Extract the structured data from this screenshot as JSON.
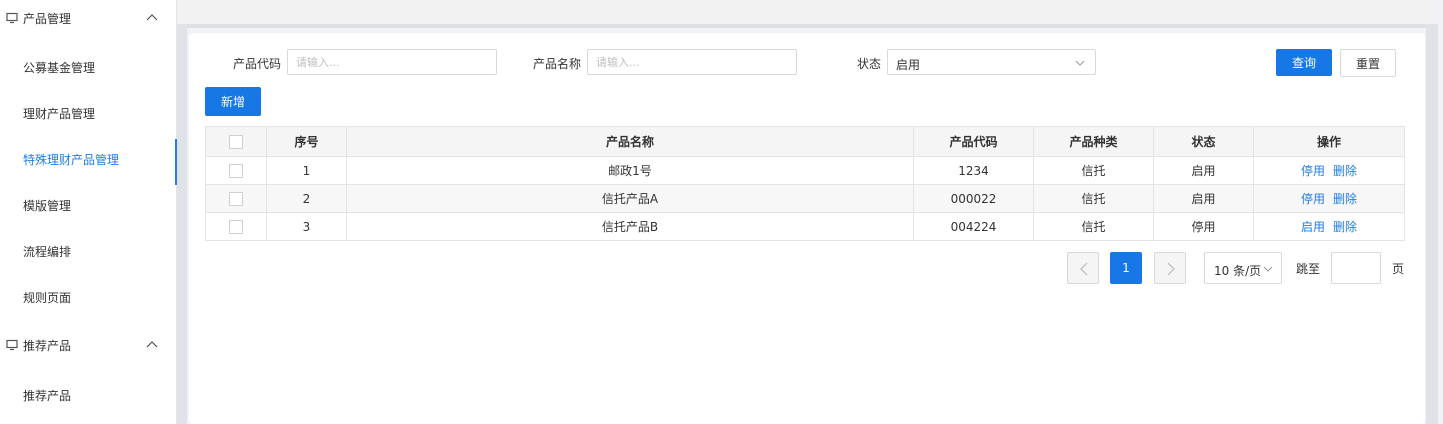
{
  "sidebar": {
    "groups": [
      {
        "label": "产品管理",
        "icon": "monitor-icon",
        "expanded": true,
        "items": [
          {
            "label": "公募基金管理"
          },
          {
            "label": "理财产品管理"
          },
          {
            "label": "特殊理财产品管理",
            "active": true
          },
          {
            "label": "模版管理"
          },
          {
            "label": "流程编排"
          },
          {
            "label": "规则页面"
          }
        ]
      },
      {
        "label": "推荐产品",
        "icon": "monitor-icon",
        "expanded": true,
        "items": [
          {
            "label": "推荐产品"
          }
        ]
      }
    ]
  },
  "filters": {
    "product_code_label": "产品代码",
    "product_code_placeholder": "请输入...",
    "product_code_value": "",
    "product_name_label": "产品名称",
    "product_name_placeholder": "请输入...",
    "product_name_value": "",
    "status_label": "状态",
    "status_value": "启用"
  },
  "buttons": {
    "query": "查询",
    "reset": "重置",
    "add": "新增"
  },
  "table": {
    "columns": [
      "序号",
      "产品名称",
      "产品代码",
      "产品种类",
      "状态",
      "操作"
    ],
    "rows": [
      {
        "index": "1",
        "name": "邮政1号",
        "code": "1234",
        "type": "信托",
        "status": "启用",
        "action_toggle": "停用",
        "action_delete": "删除"
      },
      {
        "index": "2",
        "name": "信托产品A",
        "code": "000022",
        "type": "信托",
        "status": "启用",
        "action_toggle": "停用",
        "action_delete": "删除"
      },
      {
        "index": "3",
        "name": "信托产品B",
        "code": "004224",
        "type": "信托",
        "status": "停用",
        "action_toggle": "启用",
        "action_delete": "删除"
      }
    ]
  },
  "pagination": {
    "current_page": "1",
    "page_size": "10 条/页",
    "jump_label": "跳至",
    "jump_value": "",
    "page_suffix": "页"
  },
  "colors": {
    "accent": "#1677e5",
    "link": "#1e7ee6"
  }
}
